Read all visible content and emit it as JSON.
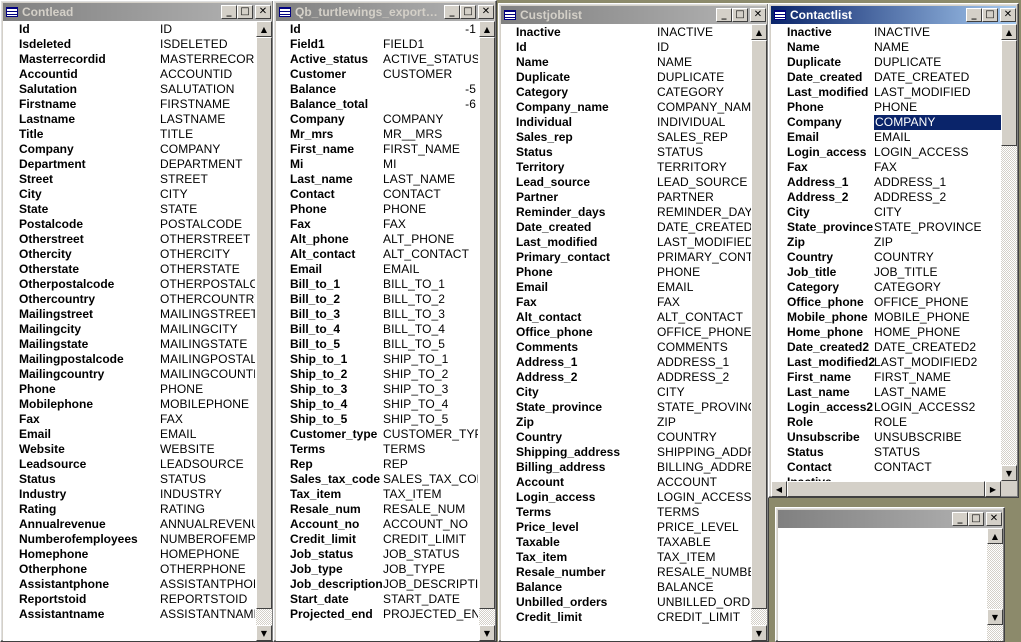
{
  "windows": [
    {
      "title": "Contlead",
      "fields": [
        [
          "Id",
          "ID"
        ],
        [
          "Isdeleted",
          "ISDELETED"
        ],
        [
          "Masterrecordid",
          "MASTERRECORDI"
        ],
        [
          "Accountid",
          "ACCOUNTID"
        ],
        [
          "Salutation",
          "SALUTATION"
        ],
        [
          "Firstname",
          "FIRSTNAME"
        ],
        [
          "Lastname",
          "LASTNAME"
        ],
        [
          "Title",
          "TITLE"
        ],
        [
          "Company",
          "COMPANY"
        ],
        [
          "Department",
          "DEPARTMENT"
        ],
        [
          "Street",
          "STREET"
        ],
        [
          "City",
          "CITY"
        ],
        [
          "State",
          "STATE"
        ],
        [
          "Postalcode",
          "POSTALCODE"
        ],
        [
          "Otherstreet",
          "OTHERSTREET"
        ],
        [
          "Othercity",
          "OTHERCITY"
        ],
        [
          "Otherstate",
          "OTHERSTATE"
        ],
        [
          "Otherpostalcode",
          "OTHERPOSTALCO"
        ],
        [
          "Othercountry",
          "OTHERCOUNTRY"
        ],
        [
          "Mailingstreet",
          "MAILINGSTREET"
        ],
        [
          "Mailingcity",
          "MAILINGCITY"
        ],
        [
          "Mailingstate",
          "MAILINGSTATE"
        ],
        [
          "Mailingpostalcode",
          "MAILINGPOSTALCO"
        ],
        [
          "Mailingcountry",
          "MAILINGCOUNTRY"
        ],
        [
          "Phone",
          "PHONE"
        ],
        [
          "Mobilephone",
          "MOBILEPHONE"
        ],
        [
          "Fax",
          "FAX"
        ],
        [
          "Email",
          "EMAIL"
        ],
        [
          "Website",
          "WEBSITE"
        ],
        [
          "Leadsource",
          "LEADSOURCE"
        ],
        [
          "Status",
          "STATUS"
        ],
        [
          "Industry",
          "INDUSTRY"
        ],
        [
          "Rating",
          "RATING"
        ],
        [
          "Annualrevenue",
          "ANNUALREVENUE"
        ],
        [
          "Numberofemployees",
          "NUMBEROFEMPLO"
        ],
        [
          "Homephone",
          "HOMEPHONE"
        ],
        [
          "Otherphone",
          "OTHERPHONE"
        ],
        [
          "Assistantphone",
          "ASSISTANTPHONE"
        ],
        [
          "Reportstoid",
          "REPORTSTOID"
        ],
        [
          "Assistantname",
          "ASSISTANTNAME"
        ]
      ]
    },
    {
      "title": "Qb_turtlewings_export_custo...",
      "fields": [
        [
          "Id",
          "-1"
        ],
        [
          "Field1",
          "FIELD1"
        ],
        [
          "Active_status",
          "ACTIVE_STATUS"
        ],
        [
          "Customer",
          "CUSTOMER"
        ],
        [
          "Balance",
          "-5"
        ],
        [
          "Balance_total",
          "-6"
        ],
        [
          "Company",
          "COMPANY"
        ],
        [
          "Mr_mrs",
          "MR__MRS"
        ],
        [
          "First_name",
          "FIRST_NAME"
        ],
        [
          "Mi",
          "MI"
        ],
        [
          "Last_name",
          "LAST_NAME"
        ],
        [
          "Contact",
          "CONTACT"
        ],
        [
          "Phone",
          "PHONE"
        ],
        [
          "Fax",
          "FAX"
        ],
        [
          "Alt_phone",
          "ALT_PHONE"
        ],
        [
          "Alt_contact",
          "ALT_CONTACT"
        ],
        [
          "Email",
          "EMAIL"
        ],
        [
          "Bill_to_1",
          "BILL_TO_1"
        ],
        [
          "Bill_to_2",
          "BILL_TO_2"
        ],
        [
          "Bill_to_3",
          "BILL_TO_3"
        ],
        [
          "Bill_to_4",
          "BILL_TO_4"
        ],
        [
          "Bill_to_5",
          "BILL_TO_5"
        ],
        [
          "Ship_to_1",
          "SHIP_TO_1"
        ],
        [
          "Ship_to_2",
          "SHIP_TO_2"
        ],
        [
          "Ship_to_3",
          "SHIP_TO_3"
        ],
        [
          "Ship_to_4",
          "SHIP_TO_4"
        ],
        [
          "Ship_to_5",
          "SHIP_TO_5"
        ],
        [
          "Customer_type",
          "CUSTOMER_TYPE"
        ],
        [
          "Terms",
          "TERMS"
        ],
        [
          "Rep",
          "REP"
        ],
        [
          "Sales_tax_code",
          "SALES_TAX_CODE"
        ],
        [
          "Tax_item",
          "TAX_ITEM"
        ],
        [
          "Resale_num",
          "RESALE_NUM"
        ],
        [
          "Account_no",
          "ACCOUNT_NO"
        ],
        [
          "Credit_limit",
          "CREDIT_LIMIT"
        ],
        [
          "Job_status",
          "JOB_STATUS"
        ],
        [
          "Job_type",
          "JOB_TYPE"
        ],
        [
          "Job_description",
          "JOB_DESCRIPTION"
        ],
        [
          "Start_date",
          "START_DATE"
        ],
        [
          "Projected_end",
          "PROJECTED_END"
        ]
      ],
      "right_aligned": [
        0,
        4,
        5
      ]
    },
    {
      "title": "Custjoblist",
      "fields": [
        [
          "Inactive",
          "INACTIVE"
        ],
        [
          "Id",
          "ID"
        ],
        [
          "Name",
          "NAME"
        ],
        [
          "Duplicate",
          "DUPLICATE"
        ],
        [
          "Category",
          "CATEGORY"
        ],
        [
          "Company_name",
          "COMPANY_NAME"
        ],
        [
          "Individual",
          "INDIVIDUAL"
        ],
        [
          "Sales_rep",
          "SALES_REP"
        ],
        [
          "Status",
          "STATUS"
        ],
        [
          "Territory",
          "TERRITORY"
        ],
        [
          "Lead_source",
          "LEAD_SOURCE"
        ],
        [
          "Partner",
          "PARTNER"
        ],
        [
          "Reminder_days",
          "REMINDER_DAYS"
        ],
        [
          "Date_created",
          "DATE_CREATED"
        ],
        [
          "Last_modified",
          "LAST_MODIFIED"
        ],
        [
          "Primary_contact",
          "PRIMARY_CONTACT"
        ],
        [
          "Phone",
          "PHONE"
        ],
        [
          "Email",
          "EMAIL"
        ],
        [
          "Fax",
          "FAX"
        ],
        [
          "Alt_contact",
          "ALT_CONTACT"
        ],
        [
          "Office_phone",
          "OFFICE_PHONE"
        ],
        [
          "Comments",
          "COMMENTS"
        ],
        [
          "Address_1",
          "ADDRESS_1"
        ],
        [
          "Address_2",
          "ADDRESS_2"
        ],
        [
          "City",
          "CITY"
        ],
        [
          "State_province",
          "STATE_PROVINCE"
        ],
        [
          "Zip",
          "ZIP"
        ],
        [
          "Country",
          "COUNTRY"
        ],
        [
          "Shipping_address",
          "SHIPPING_ADDRES"
        ],
        [
          "Billing_address",
          "BILLING_ADDRESS"
        ],
        [
          "Account",
          "ACCOUNT"
        ],
        [
          "Login_access",
          "LOGIN_ACCESS"
        ],
        [
          "Terms",
          "TERMS"
        ],
        [
          "Price_level",
          "PRICE_LEVEL"
        ],
        [
          "Taxable",
          "TAXABLE"
        ],
        [
          "Tax_item",
          "TAX_ITEM"
        ],
        [
          "Resale_number",
          "RESALE_NUMBER"
        ],
        [
          "Balance",
          "BALANCE"
        ],
        [
          "Unbilled_orders",
          "UNBILLED_ORDERS"
        ],
        [
          "Credit_limit",
          "CREDIT_LIMIT"
        ]
      ]
    },
    {
      "title": "Contactlist",
      "fields": [
        [
          "Inactive",
          "INACTIVE"
        ],
        [
          "Name",
          "NAME"
        ],
        [
          "Duplicate",
          "DUPLICATE"
        ],
        [
          "Date_created",
          "DATE_CREATED"
        ],
        [
          "Last_modified",
          "LAST_MODIFIED"
        ],
        [
          "Phone",
          "PHONE"
        ],
        [
          "Company",
          "COMPANY"
        ],
        [
          "Email",
          "EMAIL"
        ],
        [
          "Login_access",
          "LOGIN_ACCESS"
        ],
        [
          "Fax",
          "FAX"
        ],
        [
          "Address_1",
          "ADDRESS_1"
        ],
        [
          "Address_2",
          "ADDRESS_2"
        ],
        [
          "City",
          "CITY"
        ],
        [
          "State_province",
          "STATE_PROVINCE"
        ],
        [
          "Zip",
          "ZIP"
        ],
        [
          "Country",
          "COUNTRY"
        ],
        [
          "Job_title",
          "JOB_TITLE"
        ],
        [
          "Category",
          "CATEGORY"
        ],
        [
          "Office_phone",
          "OFFICE_PHONE"
        ],
        [
          "Mobile_phone",
          "MOBILE_PHONE"
        ],
        [
          "Home_phone",
          "HOME_PHONE"
        ],
        [
          "Date_created2",
          "DATE_CREATED2"
        ],
        [
          "Last_modified2",
          "LAST_MODIFIED2"
        ],
        [
          "First_name",
          "FIRST_NAME"
        ],
        [
          "Last_name",
          "LAST_NAME"
        ],
        [
          "Login_access2",
          "LOGIN_ACCESS2"
        ],
        [
          "Role",
          "ROLE"
        ],
        [
          "Unsubscribe",
          "UNSUBSCRIBE"
        ],
        [
          "Status",
          "STATUS"
        ],
        [
          "Contact",
          "CONTACT"
        ],
        [
          "Inactive",
          ""
        ]
      ],
      "selected_row": 6
    },
    {
      "title": "",
      "fields": []
    }
  ],
  "title_buttons": {
    "minimize": "_",
    "maximize": "□",
    "close": "✕"
  },
  "scroll_arrows": {
    "up": "▲",
    "down": "▼",
    "left": "◀",
    "right": "▶"
  }
}
